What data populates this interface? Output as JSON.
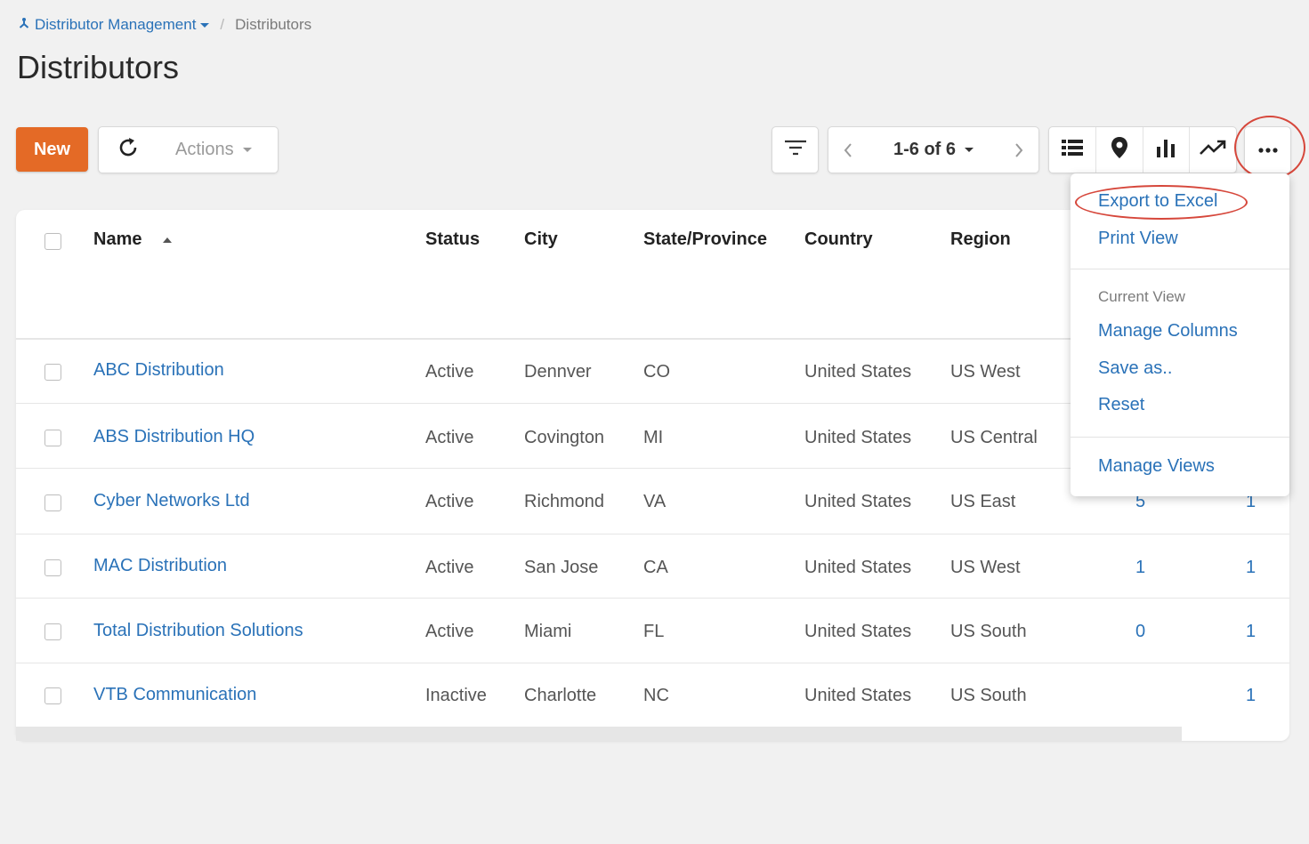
{
  "breadcrumb": {
    "parent": "Distributor Management",
    "current": "Distributors"
  },
  "page_title": "Distributors",
  "toolbar": {
    "new_label": "New",
    "actions_label": "Actions",
    "pager_label": "1-6 of 6"
  },
  "table": {
    "columns": [
      "Name",
      "Status",
      "City",
      "State/Province",
      "Country",
      "Region"
    ],
    "rows": [
      {
        "name": "ABC Distribution",
        "status": "Active",
        "city": "Dennver",
        "state": "CO",
        "country": "United States",
        "region": "US West",
        "c7": "",
        "c8": ""
      },
      {
        "name": "ABS Distribution HQ",
        "status": "Active",
        "city": "Covington",
        "state": "MI",
        "country": "United States",
        "region": "US Central",
        "c7": "",
        "c8": ""
      },
      {
        "name": "Cyber Networks Ltd",
        "status": "Active",
        "city": "Richmond",
        "state": "VA",
        "country": "United States",
        "region": "US East",
        "c7": "5",
        "c8": "1"
      },
      {
        "name": "MAC Distribution",
        "status": "Active",
        "city": "San Jose",
        "state": "CA",
        "country": "United States",
        "region": "US West",
        "c7": "1",
        "c8": "1"
      },
      {
        "name": "Total Distribution Solutions",
        "status": "Active",
        "city": "Miami",
        "state": "FL",
        "country": "United States",
        "region": "US South",
        "c7": "0",
        "c8": "1"
      },
      {
        "name": "VTB Communication",
        "status": "Inactive",
        "city": "Charlotte",
        "state": "NC",
        "country": "United States",
        "region": "US South",
        "c7": "",
        "c8": "1"
      }
    ]
  },
  "menu": {
    "export_excel": "Export to Excel",
    "print_view": "Print View",
    "current_view_heading": "Current View",
    "manage_columns": "Manage Columns",
    "save_as": "Save as..",
    "reset": "Reset",
    "manage_views": "Manage Views"
  },
  "colors": {
    "accent": "#2a72b8",
    "new_button": "#e46a26",
    "highlight": "#d6473b"
  }
}
